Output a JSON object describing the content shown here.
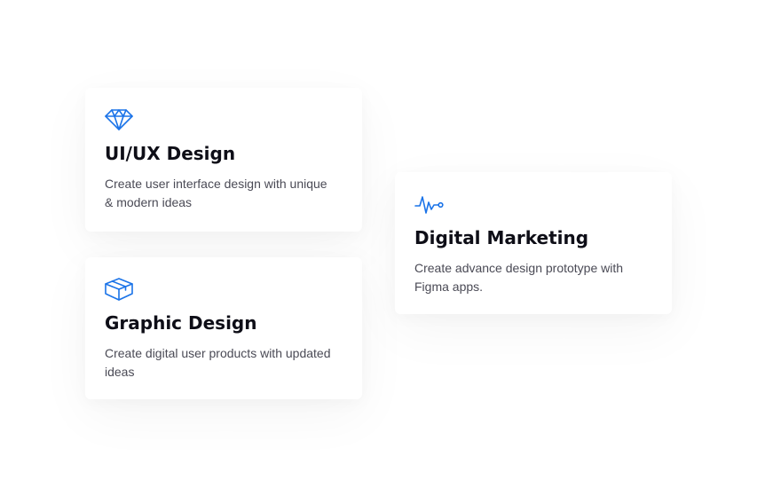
{
  "colors": {
    "accent": "#1a73e8",
    "title": "#0e0e17",
    "text": "#4a4a55"
  },
  "services": [
    {
      "icon": "diamond-icon",
      "title": "UI/UX Design",
      "description": "Create user interface design with unique & modern ideas"
    },
    {
      "icon": "box-icon",
      "title": "Graphic Design",
      "description": "Create digital user products with updated ideas"
    },
    {
      "icon": "pulse-icon",
      "title": "Digital Marketing",
      "description": "Create advance design prototype with Figma apps."
    }
  ]
}
